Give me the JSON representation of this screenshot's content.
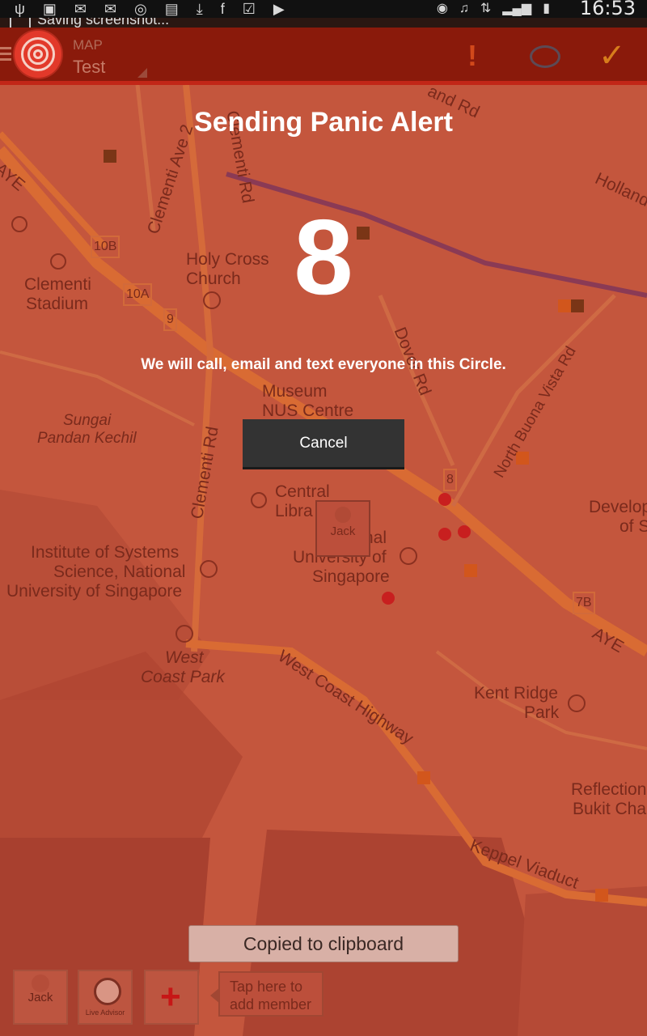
{
  "status_bar": {
    "time": "16:53",
    "icons": [
      "usb-icon",
      "image-icon",
      "email-icon",
      "email-icon",
      "app-icon",
      "app-icon",
      "download-icon",
      "facebook-icon",
      "check-icon",
      "play-icon"
    ],
    "right_icons": [
      "eye-icon",
      "mute-icon",
      "sync-icon",
      "signal-icon",
      "battery-icon"
    ]
  },
  "ticker": {
    "text": "Saving screenshot..."
  },
  "action_bar": {
    "subtitle": "MAP",
    "title": "Test",
    "alert_glyph": "!",
    "check_glyph": "✓"
  },
  "panic": {
    "title": "Sending Panic Alert",
    "countdown": "8",
    "message": "We will call, email and text everyone in this Circle.",
    "cancel_label": "Cancel"
  },
  "map": {
    "labels": [
      {
        "text": "Clementi Ave 2"
      },
      {
        "text": "Clementi Rd"
      },
      {
        "text": "Holy Cross"
      },
      {
        "text": "Church"
      },
      {
        "text": "Clementi"
      },
      {
        "text": "Stadium"
      },
      {
        "text": "10B"
      },
      {
        "text": "10A"
      },
      {
        "text": "9"
      },
      {
        "text": "AYE"
      },
      {
        "text": "Museum"
      },
      {
        "text": "NUS Centre"
      },
      {
        "text": "Sungai"
      },
      {
        "text": "Pandan Kechil"
      },
      {
        "text": "Clementi Rd"
      },
      {
        "text": "Central"
      },
      {
        "text": "Libra"
      },
      {
        "text": "nal"
      },
      {
        "text": "University of"
      },
      {
        "text": "Singapore"
      },
      {
        "text": "Institute of Systems"
      },
      {
        "text": "Science, National"
      },
      {
        "text": "University of Singapore"
      },
      {
        "text": "West"
      },
      {
        "text": "Coast Park"
      },
      {
        "text": "West Coast Highway"
      },
      {
        "text": "Kent Ridge"
      },
      {
        "text": "Park"
      },
      {
        "text": "Reflection"
      },
      {
        "text": "Bukit Cha"
      },
      {
        "text": "Keppel Viaduct"
      },
      {
        "text": "7B"
      },
      {
        "text": "AYE"
      },
      {
        "text": "8"
      },
      {
        "text": "Dover Rd"
      },
      {
        "text": "North Buona Vista Rd"
      },
      {
        "text": "Holland"
      },
      {
        "text": "and Rd"
      },
      {
        "text": "Develop"
      },
      {
        "text": "of S"
      }
    ],
    "marker_name": "Jack"
  },
  "toast": {
    "text": "Copied to clipboard"
  },
  "tray": {
    "member_name": "Jack",
    "advisor_label": "Live Advisor",
    "hint": "Tap here to add member"
  }
}
